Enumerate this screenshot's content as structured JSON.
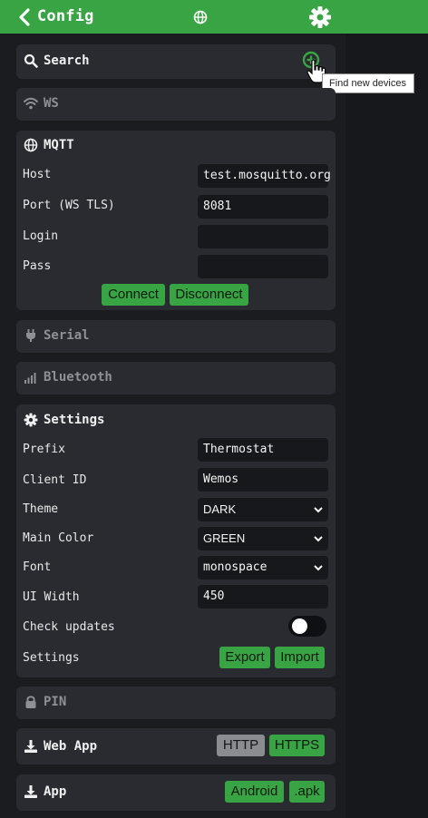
{
  "header": {
    "title": "Config"
  },
  "search": {
    "title": "Search",
    "tooltip": "Find new devices"
  },
  "ws": {
    "title": "WS"
  },
  "mqtt": {
    "title": "MQTT",
    "host_label": "Host",
    "host_value": "test.mosquitto.org",
    "port_label": "Port (WS TLS)",
    "port_value": "8081",
    "login_label": "Login",
    "login_value": "",
    "pass_label": "Pass",
    "pass_value": "",
    "connect_label": "Connect",
    "disconnect_label": "Disconnect"
  },
  "serial": {
    "title": "Serial"
  },
  "bluetooth": {
    "title": "Bluetooth"
  },
  "settings": {
    "title": "Settings",
    "prefix_label": "Prefix",
    "prefix_value": "Thermostat",
    "client_id_label": "Client ID",
    "client_id_value": "Wemos",
    "theme_label": "Theme",
    "theme_value": "DARK",
    "main_color_label": "Main Color",
    "main_color_value": "GREEN",
    "font_label": "Font",
    "font_value": "monospace",
    "ui_width_label": "UI Width",
    "ui_width_value": "450",
    "check_updates_label": "Check updates",
    "check_updates_on": false,
    "settings_label": "Settings",
    "export_label": "Export",
    "import_label": "Import"
  },
  "pin": {
    "title": "PIN"
  },
  "webapp": {
    "title": "Web App",
    "http_label": "HTTP",
    "https_label": "HTTPS"
  },
  "app": {
    "title": "App",
    "android_label": "Android",
    "apk_label": ".apk"
  },
  "colors": {
    "accent": "#38a443",
    "background": "#17181b",
    "card": "#2a2b30",
    "field": "#17181b"
  }
}
